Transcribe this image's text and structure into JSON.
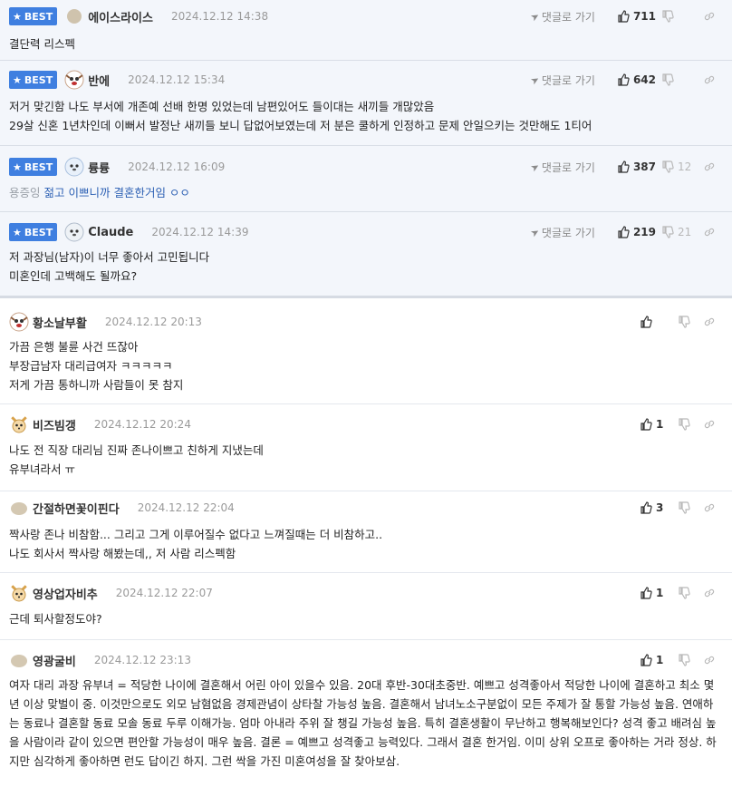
{
  "best_comments": [
    {
      "nick": "에이스라이스",
      "date": "2024.12.12 14:38",
      "reply_label": "댓글로 가기",
      "likes": "711",
      "dislikes": "",
      "avatar": "dot",
      "lines": [
        "결단력 리스펙"
      ]
    },
    {
      "nick": "반에",
      "date": "2024.12.12 15:34",
      "reply_label": "댓글로 가기",
      "likes": "642",
      "dislikes": "",
      "avatar": "dog",
      "lines": [
        "저거 맞긴함 나도 부서에 개존예 선배 한명 있었는데 남편있어도 들이대는 새끼들 개많았음",
        "29살 신혼 1년차인데 이뻐서 발정난 새끼들 보니 답없어보였는데 저 분은 쿨하게 인정하고 문제 안일으키는 것만해도 1티어"
      ]
    },
    {
      "nick": "륭륭",
      "date": "2024.12.12 16:09",
      "reply_label": "댓글로 가기",
      "likes": "387",
      "dislikes": "12",
      "avatar": "pup",
      "mention": "용증잉",
      "lines": [
        "젊고 이쁘니까 결혼한거임 ㅇㅇ"
      ]
    },
    {
      "nick": "Claude",
      "date": "2024.12.12 14:39",
      "reply_label": "댓글로 가기",
      "likes": "219",
      "dislikes": "21",
      "avatar": "pup",
      "lines": [
        "저 과장님(남자)이 너무 좋아서 고민됩니다",
        "미혼인데 고백해도 될까요?"
      ]
    }
  ],
  "comments": [
    {
      "nick": "황소날부활",
      "date": "2024.12.12 20:13",
      "likes": "",
      "avatar": "dog",
      "lines": [
        "가끔 은행 불륜 사건 뜨잖아",
        "부장급남자 대리급여자 ㅋㅋㅋㅋㅋ",
        "저게 가끔 통하니까 사람들이 못 참지"
      ]
    },
    {
      "nick": "비즈빔갱",
      "date": "2024.12.12 20:24",
      "likes": "1",
      "avatar": "fox",
      "lines": [
        "나도 전 직장 대리님 진짜 존나이쁘고 친하게 지냈는데",
        "유부녀라서 ㅠ"
      ]
    },
    {
      "nick": "간절하면꽃이핀다",
      "date": "2024.12.12 22:04",
      "likes": "3",
      "avatar": "dot",
      "lines": [
        "짝사랑 존나 비참함... 그리고 그게 이루어질수 없다고 느껴질때는 더 비참하고..",
        "나도 회사서 짝사랑 해봤는데,, 저 사람 리스펙함"
      ]
    },
    {
      "nick": "영상업자비추",
      "date": "2024.12.12 22:07",
      "likes": "1",
      "avatar": "fox",
      "lines": [
        "근데 퇴사할정도야?"
      ]
    },
    {
      "nick": "영광굴비",
      "date": "2024.12.12 23:13",
      "likes": "1",
      "avatar": "dot",
      "lines": [
        "여자 대리 과장 유부녀 = 적당한 나이에 결혼해서 어린 아이 있을수 있음. 20대 후반-30대초중반. 예쁘고 성격좋아서 적당한 나이에 결혼하고 최소 몇년 이상 맞벌이 중. 이것만으로도 외모 남혐없음 경제관념이 상타찰 가능성 높음. 결혼해서 남녀노소구분없이 모든 주제가 잘 통할 가능성 높음. 연애하는 동료나 결혼할 동료 모솔 동료 두루 이해가능. 엄마 아내라 주위 잘 챙길 가능성 높음. 특히 결혼생활이 무난하고 행복해보인다? 성격 좋고 배려심 높을 사람이라 같이 있으면 편안할 가능성이 매우 높음. 결론 = 예쁘고 성격좋고 능력있다. 그래서 결혼 한거임. 이미 상위 오프로 좋아하는 거라 정상. 하지만 심각하게 좋아하면 런도 답이긴 하지. 그런 싹을 가진 미혼여성을 잘 찾아보삼."
      ]
    }
  ],
  "best_label": "BEST",
  "colors": {
    "best_bg": "#f3f6fb",
    "badge": "#3f7fe0",
    "mention": "#2b5fb3"
  }
}
